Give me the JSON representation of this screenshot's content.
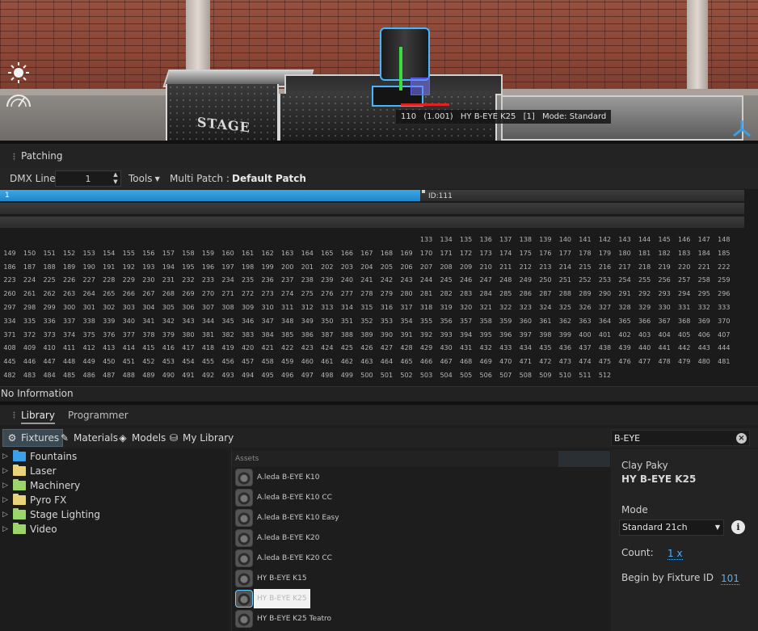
{
  "viewport": {
    "stage_label": "STAGE",
    "tooltip": {
      "id": "110",
      "address": "(1.001)",
      "fixture": "HY B-EYE K25",
      "index": "[1]",
      "mode": "Mode: Standard"
    },
    "icons": [
      "sun-icon",
      "gauge-icon",
      "gizmo-icon"
    ]
  },
  "patching": {
    "title": "Patching",
    "dmx_line_label": "DMX Line",
    "dmx_line_value": "1",
    "tools_label": "Tools",
    "multi_patch_label": "Multi Patch :",
    "patch_name": "Default Patch",
    "universe_fill_label": "1",
    "universe_fill_fraction": 0.565,
    "id_label": "ID:111",
    "status": "No Information"
  },
  "library": {
    "tabs": [
      "Library",
      "Programmer"
    ],
    "active_tab": "Library",
    "categories": [
      "Fixtures",
      "Materials",
      "Models",
      "My Library"
    ],
    "search_value": "B-EYE",
    "tree": [
      {
        "label": "Fountains",
        "color": "#3aa0e8"
      },
      {
        "label": "Laser",
        "color": "#e8d27a"
      },
      {
        "label": "Machinery",
        "color": "#9cd66a"
      },
      {
        "label": "Pyro FX",
        "color": "#e8d27a"
      },
      {
        "label": "Stage Lighting",
        "color": "#9cd66a"
      },
      {
        "label": "Video",
        "color": "#9cd66a"
      }
    ],
    "assets_header": "Assets",
    "assets": [
      "A.leda B-EYE K10",
      "A.leda B-EYE K10 CC",
      "A.leda B-EYE K10 Easy",
      "A.leda B-EYE K20",
      "A.leda B-EYE K20 CC",
      "HY B-EYE K15",
      "HY B-EYE K25",
      "HY B-EYE K25 Teatro"
    ],
    "selected_asset_index": 6,
    "details": {
      "manufacturer": "Clay Paky",
      "fixture": "HY B-EYE K25",
      "mode_label": "Mode",
      "mode_value": "Standard 21ch",
      "count_label": "Count:",
      "count_value": "1 x",
      "begin_label": "Begin by Fixture ID",
      "begin_value": "101"
    }
  }
}
